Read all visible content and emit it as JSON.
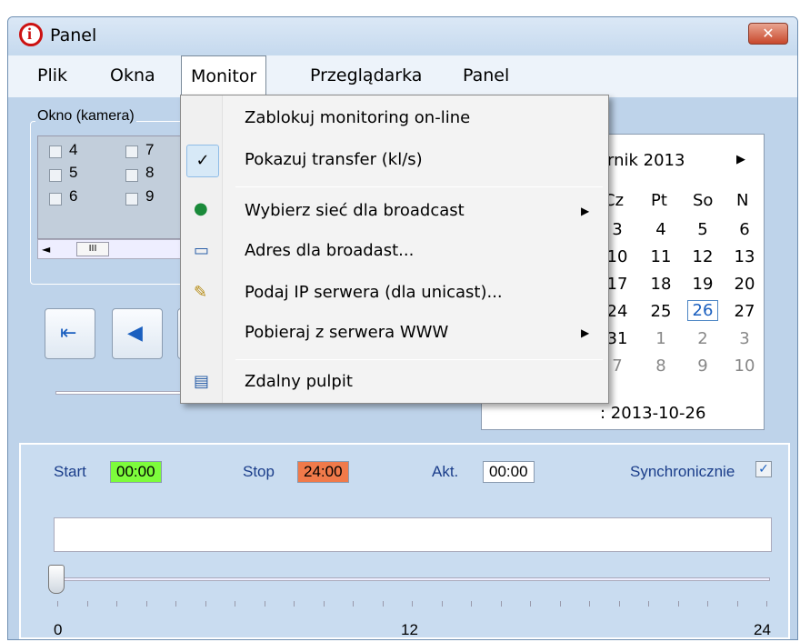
{
  "window": {
    "title": "Panel",
    "close_label": "✕"
  },
  "menu": {
    "items": [
      "Plik",
      "Okna",
      "Monitor",
      "Przeglądarka",
      "Panel"
    ]
  },
  "camera_group": {
    "label": "Okno (kamera)",
    "checkboxes": [
      "4",
      "7",
      "5",
      "8",
      "6",
      "9"
    ],
    "scroll_thumb": "III"
  },
  "calendar": {
    "month": "rnik 2013",
    "days_of_week": [
      "Cz",
      "Pt",
      "So",
      "N"
    ],
    "rows": [
      [
        "3",
        "4",
        "5",
        "6"
      ],
      [
        "10",
        "11",
        "12",
        "13"
      ],
      [
        "17",
        "18",
        "19",
        "20"
      ],
      [
        "24",
        "25",
        "26",
        "27"
      ],
      [
        "31",
        "1",
        "2",
        "3"
      ],
      [
        "7",
        "8",
        "9",
        "10"
      ]
    ],
    "footer": ": 2013-10-26"
  },
  "dropdown": {
    "items": [
      {
        "label": "Zablokuj monitoring on-line"
      },
      {
        "label": "Pokazuj transfer (kl/s)"
      },
      {
        "label": "Wybierz sieć dla broadcast"
      },
      {
        "label": "Adres dla broadast..."
      },
      {
        "label": "Podaj IP serwera (dla unicast)..."
      },
      {
        "label": "Pobieraj z serwera WWW"
      },
      {
        "label": "Zdalny pulpit"
      }
    ]
  },
  "timeline": {
    "start_label": "Start",
    "start_value": "00:00",
    "stop_label": "Stop",
    "stop_value": "24:00",
    "akt_label": "Akt.",
    "akt_value": "00:00",
    "sync_label": "Synchronicznie",
    "ticks": [
      "0",
      "12",
      "24"
    ]
  },
  "colors": {
    "start_bg": "#7dfc3c",
    "stop_bg": "#f07a4a",
    "accent": "#1a5fbf"
  }
}
